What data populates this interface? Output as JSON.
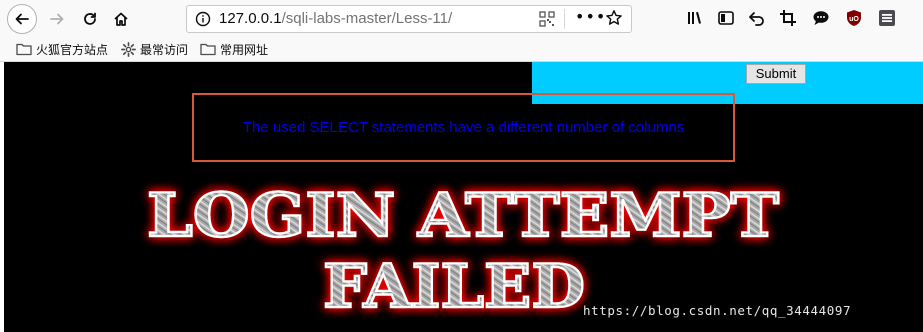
{
  "browser": {
    "url_host": "127.0.0.1",
    "url_path": "/sqli-labs-master/Less-11/",
    "url_more": "•••",
    "icons": [
      "back-icon",
      "forward-icon",
      "reload-icon",
      "home-icon",
      "info-icon",
      "qr-code-icon",
      "bookmark-star-icon",
      "library-icon",
      "sidebar-icon",
      "undo-icon",
      "crop-icon",
      "chat-icon",
      "ublock-icon",
      "menu-icon"
    ]
  },
  "bookmarks": [
    {
      "label": "火狐官方站点",
      "icon": "folder-icon"
    },
    {
      "label": "最常访问",
      "icon": "gear-icon"
    },
    {
      "label": "常用网址",
      "icon": "folder-icon"
    }
  ],
  "page": {
    "submit_label": "Submit",
    "error_message": "The used SELECT statements have a different number of columns",
    "banner_line1": "LOGIN ATTEMPT",
    "banner_line2": "FAILED",
    "watermark": "https://blog.csdn.net/qq_34444097",
    "colors": {
      "panel": "#00ccff",
      "background": "#000000",
      "error_text": "#0000ee",
      "error_border": "#d5593a",
      "banner_glow": "#ff0000"
    }
  }
}
